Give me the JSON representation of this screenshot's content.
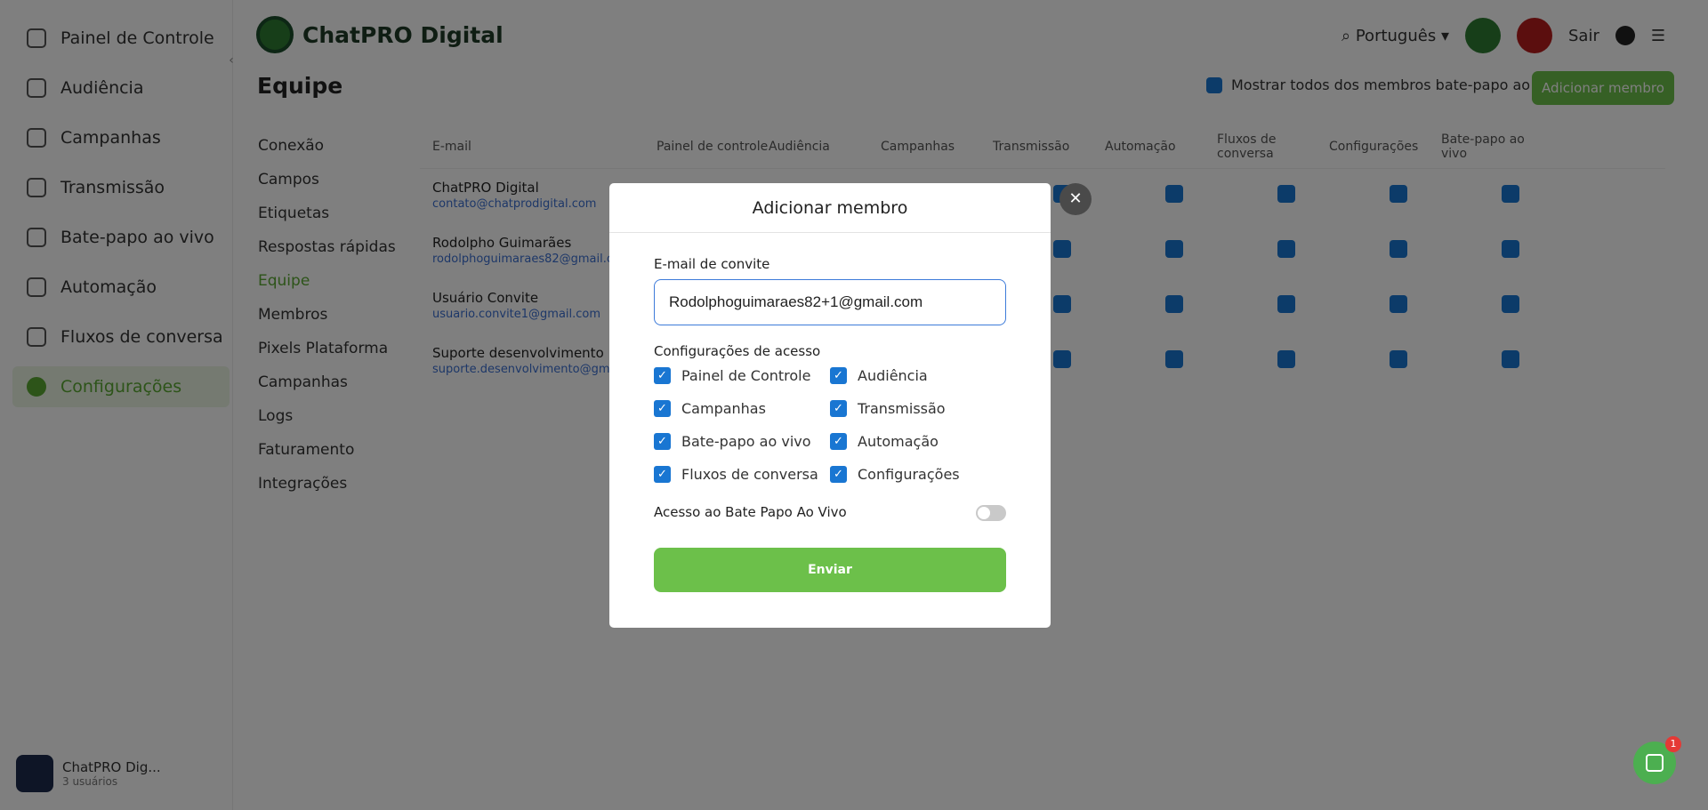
{
  "sidebar": {
    "items": [
      {
        "label": "Painel de Controle",
        "icon": "dashboard-icon"
      },
      {
        "label": "Audiência",
        "icon": "audience-icon"
      },
      {
        "label": "Campanhas",
        "icon": "campaign-icon"
      },
      {
        "label": "Transmissão",
        "icon": "broadcast-icon"
      },
      {
        "label": "Bate-papo ao vivo",
        "icon": "chat-icon"
      },
      {
        "label": "Automação",
        "icon": "automation-icon"
      },
      {
        "label": "Fluxos de conversa",
        "icon": "flow-icon"
      },
      {
        "label": "Configurações",
        "icon": "settings-icon"
      }
    ],
    "user_name": "ChatPRO Dig...",
    "user_sub": "3 usuários"
  },
  "header": {
    "brand": "ChatPRO Digital",
    "language": "Português",
    "sair": "Sair"
  },
  "page": {
    "title": "Equipe",
    "show_all_label": "Mostrar todos dos membros bate-papo ao vivo",
    "add_member_label": "Adicionar membro"
  },
  "subnav": [
    "Conexão",
    "Campos",
    "Etiquetas",
    "Respostas rápidas",
    "Equipe",
    "Membros",
    "Pixels Plataforma",
    "Campanhas",
    "Logs",
    "Faturamento",
    "Integrações"
  ],
  "table": {
    "headers": [
      "E-mail",
      "Painel de controle",
      "Audiência",
      "Campanhas",
      "Transmissão",
      "Automação",
      "Fluxos de conversa",
      "Configurações",
      "Bate-papo ao vivo"
    ],
    "rows": [
      {
        "name": "ChatPRO Digital",
        "email": "contato@chatprodigital.com"
      },
      {
        "name": "Rodolpho Guimarães",
        "email": "rodolphoguimaraes82@gmail.com"
      },
      {
        "name": "Usuário Convite",
        "email": "usuario.convite1@gmail.com"
      },
      {
        "name": "Suporte desenvolvimento",
        "email": "suporte.desenvolvimento@gmail.com"
      }
    ]
  },
  "modal": {
    "title": "Adicionar membro",
    "email_label": "E-mail de convite",
    "email_value": "Rodolphoguimaraes82+1@gmail.com",
    "access_label": "Configurações de acesso",
    "permissions": [
      {
        "label": "Painel de Controle",
        "checked": true
      },
      {
        "label": "Audiência",
        "checked": true
      },
      {
        "label": "Campanhas",
        "checked": true
      },
      {
        "label": "Transmissão",
        "checked": true
      },
      {
        "label": "Bate-papo ao vivo",
        "checked": true
      },
      {
        "label": "Automação",
        "checked": true
      },
      {
        "label": "Fluxos de conversa",
        "checked": true
      },
      {
        "label": "Configurações",
        "checked": true
      }
    ],
    "live_chat_access_label": "Acesso ao Bate Papo Ao Vivo",
    "live_chat_access_enabled": false,
    "send_label": "Enviar",
    "close_glyph": "✕"
  },
  "chat_widget": {
    "badge": "1"
  },
  "colors": {
    "brand_green": "#6cc04a",
    "checkbox_blue": "#1976d2",
    "overlay": "rgba(0,0,0,0.5)"
  }
}
